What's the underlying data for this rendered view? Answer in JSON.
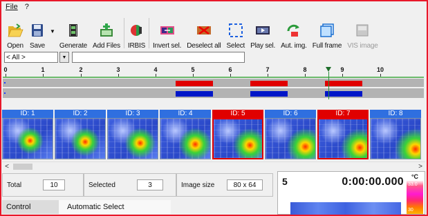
{
  "menu": {
    "items": [
      "File",
      "?"
    ]
  },
  "toolbar": {
    "buttons": [
      {
        "label": "Open",
        "icon": "folder-open-icon"
      },
      {
        "label": "Save",
        "icon": "floppy-disk-icon"
      },
      {
        "label": "Generate",
        "icon": "film-generate-icon"
      },
      {
        "label": "Add Files",
        "icon": "add-files-icon"
      },
      {
        "label": "IRBIS",
        "icon": "irbis-logo-icon"
      },
      {
        "label": "Invert sel.",
        "icon": "invert-selection-icon"
      },
      {
        "label": "Deselect all",
        "icon": "deselect-all-icon"
      },
      {
        "label": "Select",
        "icon": "select-dashed-icon"
      },
      {
        "label": "Play sel.",
        "icon": "play-selection-icon"
      },
      {
        "label": "Aut. img.",
        "icon": "automatic-image-icon"
      },
      {
        "label": "Full frame",
        "icon": "full-frame-icon"
      },
      {
        "label": "VIS image",
        "icon": "vis-image-icon",
        "disabled": true
      }
    ]
  },
  "selector": {
    "combo_value": "< All >",
    "text_value": ""
  },
  "timeline": {
    "ticks": [
      "0",
      "1",
      "2",
      "3",
      "4",
      "5",
      "6",
      "7",
      "8",
      "9",
      "10"
    ],
    "marker_at": 8.7
  },
  "thumbnails": [
    {
      "label": "ID: 1",
      "selected": false
    },
    {
      "label": "ID: 2",
      "selected": false
    },
    {
      "label": "ID: 3",
      "selected": false
    },
    {
      "label": "ID: 4",
      "selected": false
    },
    {
      "label": "ID: 5",
      "selected": true
    },
    {
      "label": "ID: 6",
      "selected": false
    },
    {
      "label": "ID: 7",
      "selected": true
    },
    {
      "label": "ID: 8",
      "selected": false
    }
  ],
  "stats": {
    "total_label": "Total",
    "total_value": "10",
    "selected_label": "Selected",
    "selected_value": "3",
    "size_label": "Image size",
    "size_value": "80 x 64"
  },
  "control": {
    "label": "Control",
    "value": "Automatic Select"
  },
  "preview": {
    "frame_number": "5",
    "timestamp": "0:00:00.000",
    "unit": "°C",
    "scale_top": "33.0",
    "scale_bottom": "30"
  },
  "colors": {
    "accent_red": "#e00000",
    "accent_blue": "#0016c8",
    "thumb_header_blue": "#2f6fe0"
  }
}
